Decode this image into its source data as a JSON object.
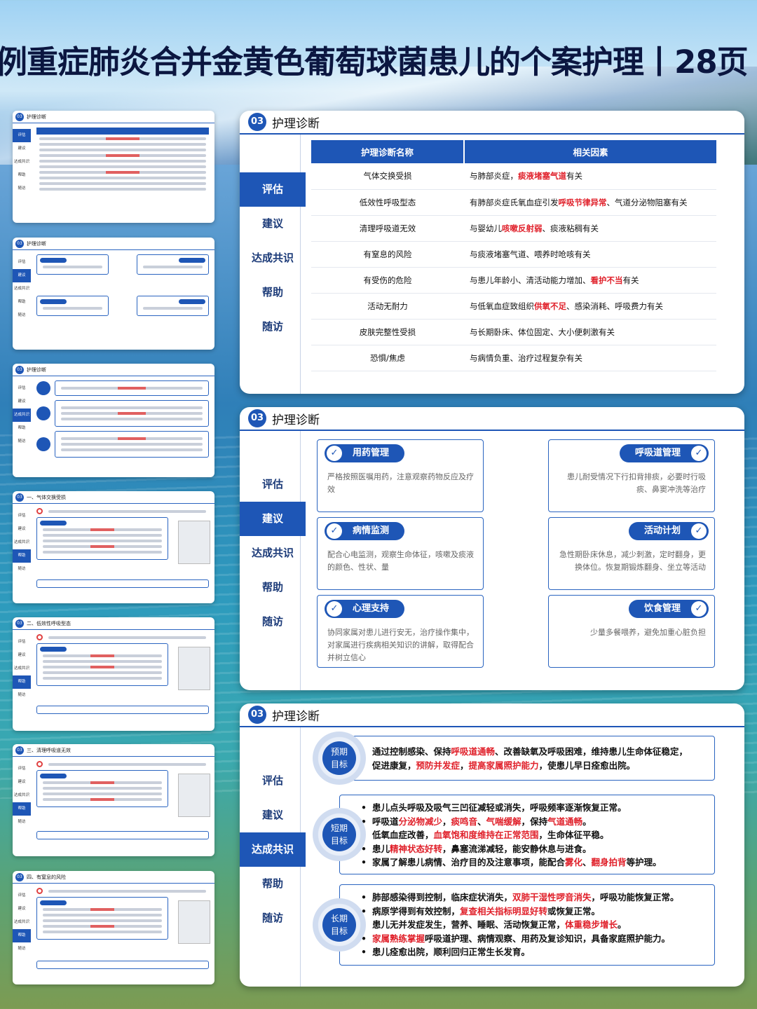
{
  "main_title": "例重症肺炎合并金黄色葡萄球菌患儿的个案护理丨28页",
  "panel_number": "03",
  "panel_title": "护理诊断",
  "thumb_titles": [
    "护理诊断",
    "护理诊断",
    "护理诊断",
    "一、气体交换受损",
    "二、低效性呼吸型态",
    "三、清理呼吸道无效",
    "四、有窒息的风险"
  ],
  "side_nav": [
    "评估",
    "建议",
    "达成共识",
    "帮助",
    "随访"
  ],
  "diagnosis_table": {
    "headers": [
      "护理诊断名称",
      "相关因素"
    ],
    "rows": [
      {
        "name": "气体交换受损",
        "f1": "与肺部炎症，",
        "r1": "痰液堵塞气道",
        "f2": "有关",
        "r2": "",
        "f3": ""
      },
      {
        "name": "低效性呼吸型态",
        "f1": "有肺部炎症氏氧血症引发",
        "r1": "呼吸节律异常",
        "f2": "、气道分泌物阻塞有关",
        "r2": "",
        "f3": ""
      },
      {
        "name": "清理呼吸道无效",
        "f1": "与婴幼儿",
        "r1": "咳嗽反射弱",
        "f2": "、痰液粘稠有关",
        "r2": "",
        "f3": ""
      },
      {
        "name": "有窒息的风险",
        "f1": "与痰液堵塞气道、喂养时呛咳有关",
        "r1": "",
        "f2": "",
        "r2": "",
        "f3": ""
      },
      {
        "name": "有受伤的危险",
        "f1": "与患儿年龄小、清活动能力增加、",
        "r1": "看护不当",
        "f2": "有关",
        "r2": "",
        "f3": ""
      },
      {
        "name": "活动无耐力",
        "f1": "与低氧血症致组织",
        "r1": "供氧不足",
        "f2": "、感染消耗、呼吸费力有关",
        "r2": "",
        "f3": ""
      },
      {
        "name": "皮肤完整性受损",
        "f1": "与长期卧床、体位固定、大小便刺激有关",
        "r1": "",
        "f2": "",
        "r2": "",
        "f3": ""
      },
      {
        "name": "恐惧/焦虑",
        "f1": "与病情负重、治疗过程复杂有关",
        "r1": "",
        "f2": "",
        "r2": "",
        "f3": ""
      }
    ]
  },
  "suggestions": {
    "left": [
      {
        "title": "用药管理",
        "text": "严格按照医嘱用药，注意观察药物反应及疗效"
      },
      {
        "title": "病情监测",
        "text": "配合心电监测，观察生命体征，咳嗽及痰液的颜色、性状、量"
      },
      {
        "title": "心理支持",
        "text": "协同家属对患儿进行安无，治疗操作集中，对家属进行疾病相关知识的讲解，取得配合并树立信心"
      }
    ],
    "right": [
      {
        "title": "呼吸道管理",
        "text": "患儿耐受情况下行扣背排痰，必要时行吸痰、鼻窦冲洗等治疗"
      },
      {
        "title": "活动计划",
        "text": "急性期卧床休息，减少刺激，定时翻身，更换体位。恢复期锻炼翻身、坐立等活动"
      },
      {
        "title": "饮食管理",
        "text": "少量多餐喂养，避免加重心脏负担"
      }
    ]
  },
  "check_icon": "check-icon",
  "goals": {
    "expected": {
      "label1": "预期",
      "label2": "目标",
      "lines": [
        [
          {
            "t": "通过控制感染、保持"
          },
          {
            "t": "呼吸道通畅",
            "r": true
          },
          {
            "t": "、改善缺氧及呼吸困难，维持患儿生命体征稳定，"
          }
        ],
        [
          {
            "t": "促进康复，"
          },
          {
            "t": "预防并发症",
            "r": true
          },
          {
            "t": "，"
          },
          {
            "t": "提高家属照护能力",
            "r": true
          },
          {
            "t": "，使患儿早日痊愈出院。"
          }
        ]
      ]
    },
    "short": {
      "label1": "短期",
      "label2": "目标",
      "lines": [
        [
          {
            "t": "患儿点头呼吸及吸气三凹征减轻或消失，呼吸频率逐渐恢复正常。"
          }
        ],
        [
          {
            "t": "呼吸道"
          },
          {
            "t": "分泌物减少",
            "r": true
          },
          {
            "t": "，"
          },
          {
            "t": "痰鸣音",
            "r": true
          },
          {
            "t": "、"
          },
          {
            "t": "气喘缓解",
            "r": true
          },
          {
            "t": "，保持"
          },
          {
            "t": "气道通畅",
            "r": true
          },
          {
            "t": "。"
          }
        ],
        [
          {
            "t": "低氧血症改善，"
          },
          {
            "t": "血氧饱和度维持在正常范围",
            "r": true
          },
          {
            "t": "，生命体征平稳。"
          }
        ],
        [
          {
            "t": "患儿"
          },
          {
            "t": "精神状态好转",
            "r": true
          },
          {
            "t": "，鼻塞流涕减轻，能安静休息与进食。"
          }
        ],
        [
          {
            "t": "家属了解患儿病情、治疗目的及注意事项，能配合"
          },
          {
            "t": "雾化",
            "r": true
          },
          {
            "t": "、"
          },
          {
            "t": "翻身拍背",
            "r": true
          },
          {
            "t": "等护理。"
          }
        ]
      ]
    },
    "long": {
      "label1": "长期",
      "label2": "目标",
      "lines": [
        [
          {
            "t": "肺部感染得到控制，临床症状消失，"
          },
          {
            "t": "双肺干湿性啰音消失",
            "r": true
          },
          {
            "t": "，呼吸功能恢复正常。"
          }
        ],
        [
          {
            "t": "病原学得到有效控制，"
          },
          {
            "t": "复查相关指标明显好转",
            "r": true
          },
          {
            "t": "或恢复正常。"
          }
        ],
        [
          {
            "t": "患儿无并发症发生，营养、睡眠、活动恢复正常，"
          },
          {
            "t": "体重稳步增长",
            "r": true
          },
          {
            "t": "。"
          }
        ],
        [
          {
            "t": "家属熟练掌握",
            "r": true
          },
          {
            "t": "呼吸道护理、病情观察、用药及复诊知识，具备家庭照护能力。"
          }
        ],
        [
          {
            "t": "患儿痊愈出院，顺利回归正常生长发育。"
          }
        ]
      ]
    }
  },
  "colors": {
    "accent": "#1e56b6",
    "highlight": "#e0202a"
  }
}
